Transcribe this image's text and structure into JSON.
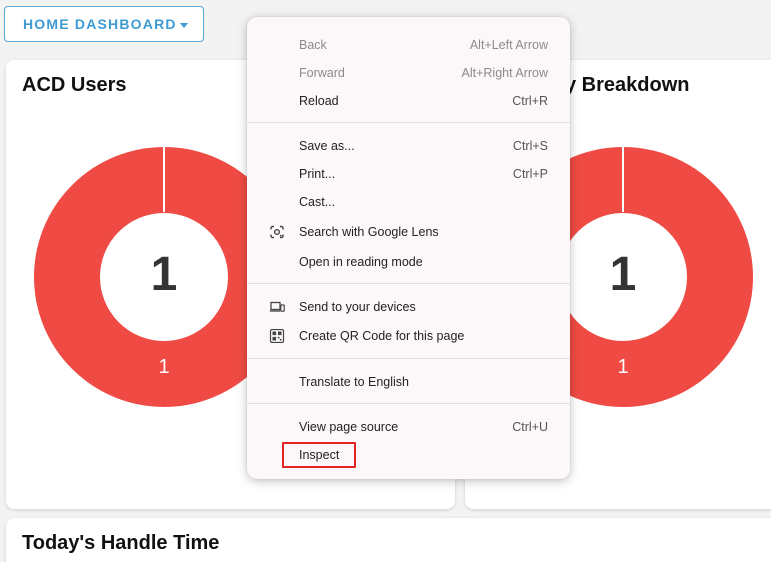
{
  "header": {
    "dashboard_label": "HOME DASHBOARD"
  },
  "cards": {
    "acd_users": {
      "title": "ACD Users",
      "center_value": "1",
      "slice_label": "1"
    },
    "breakdown": {
      "title": "y Breakdown",
      "center_value": "1",
      "slice_label": "1"
    },
    "handle_time": {
      "title": "Today's Handle Time"
    }
  },
  "colors": {
    "donut": "#ef4b44",
    "accent": "#3d9bd3",
    "highlight": "#e02424"
  },
  "context_menu": {
    "items": [
      {
        "label": "Back",
        "shortcut": "Alt+Left Arrow",
        "disabled": true
      },
      {
        "label": "Forward",
        "shortcut": "Alt+Right Arrow",
        "disabled": true
      },
      {
        "label": "Reload",
        "shortcut": "Ctrl+R"
      },
      {
        "label": "Save as...",
        "shortcut": "Ctrl+S"
      },
      {
        "label": "Print...",
        "shortcut": "Ctrl+P"
      },
      {
        "label": "Cast..."
      },
      {
        "label": "Search with Google Lens",
        "icon": "google-lens-icon"
      },
      {
        "label": "Open in reading mode"
      },
      {
        "label": "Send to your devices",
        "icon": "devices-icon"
      },
      {
        "label": "Create QR Code for this page",
        "icon": "qr-code-icon"
      },
      {
        "label": "Translate to English"
      },
      {
        "label": "View page source",
        "shortcut": "Ctrl+U"
      },
      {
        "label": "Inspect",
        "highlighted": true
      }
    ]
  }
}
